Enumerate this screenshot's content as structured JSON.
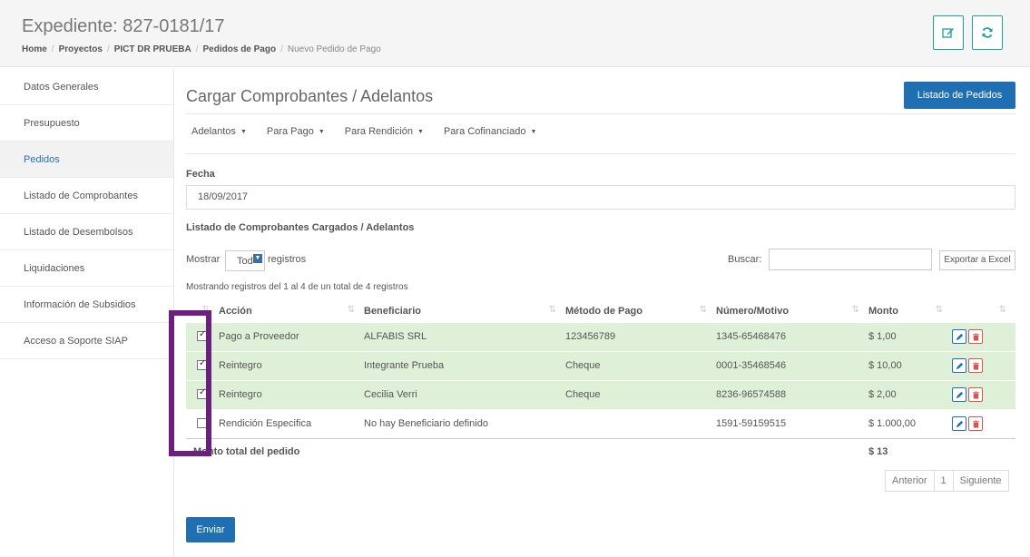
{
  "header": {
    "title": "Expediente: 827-0181/17",
    "breadcrumb": [
      "Home",
      "Proyectos",
      "PICT DR PRUEBA",
      "Pedidos de Pago",
      "Nuevo Pedido de Pago"
    ],
    "buttons": [
      {
        "icon": "edit-icon"
      },
      {
        "icon": "refresh-icon"
      }
    ],
    "accent_color": "#17a2a2"
  },
  "sidebar": {
    "items": [
      {
        "label": "Datos Generales",
        "active": false
      },
      {
        "label": "Presupuesto",
        "active": false
      },
      {
        "label": "Pedidos",
        "active": true
      },
      {
        "label": "Listado de Comprobantes",
        "active": false
      },
      {
        "label": "Listado de Desembolsos",
        "active": false
      },
      {
        "label": "Liquidaciones",
        "active": false
      },
      {
        "label": "Información de Subsidios",
        "active": false
      },
      {
        "label": "Acceso a Soporte SIAP",
        "active": false
      }
    ]
  },
  "main": {
    "title": "Cargar Comprobantes / Adelantos",
    "list_button": "Listado de Pedidos",
    "tabs": [
      "Adelantos",
      "Para Pago",
      "Para Rendición",
      "Para Cofinanciado"
    ],
    "fecha_label": "Fecha",
    "fecha_value": "18/09/2017",
    "section_title": "Listado de Comprobantes Cargados / Adelantos",
    "show_label": "Mostrar",
    "show_value": "Tod",
    "registros_label": "registros",
    "search_label": "Buscar:",
    "export_button": "Exportar a Excel",
    "info_text": "Mostrando registros del 1 al 4 de un total de 4 registros",
    "table": {
      "columns": [
        "Acción",
        "Beneficiario",
        "Método de Pago",
        "Número/Motivo",
        "Monto"
      ],
      "rows": [
        {
          "checked": true,
          "accion": "Pago a Proveedor",
          "beneficiario": "ALFABIS SRL",
          "metodo": "123456789",
          "numero": "1345-65468476",
          "monto": "$ 1,00"
        },
        {
          "checked": true,
          "accion": "Reintegro",
          "beneficiario": "Integrante Prueba",
          "metodo": "Cheque",
          "numero": "0001-35468546",
          "monto": "$ 10,00"
        },
        {
          "checked": true,
          "accion": "Reintegro",
          "beneficiario": "Cecilia Verri",
          "metodo": "Cheque",
          "numero": "8236-96574588",
          "monto": "$ 2,00"
        },
        {
          "checked": false,
          "accion": "Rendición Especifica",
          "beneficiario": "No hay Beneficiario definido",
          "metodo": "",
          "numero": "1591-59159515",
          "monto": "$ 1.000,00"
        }
      ],
      "total_label": "Monto total del pedido",
      "total_value": "$ 13"
    },
    "pager": {
      "prev": "Anterior",
      "page": "1",
      "next": "Siguiente"
    },
    "submit_button": "Enviar",
    "selected_row_color": "#dff0d8",
    "primary_color": "#1f6fb2",
    "highlight_color": "#6b1f7e"
  }
}
